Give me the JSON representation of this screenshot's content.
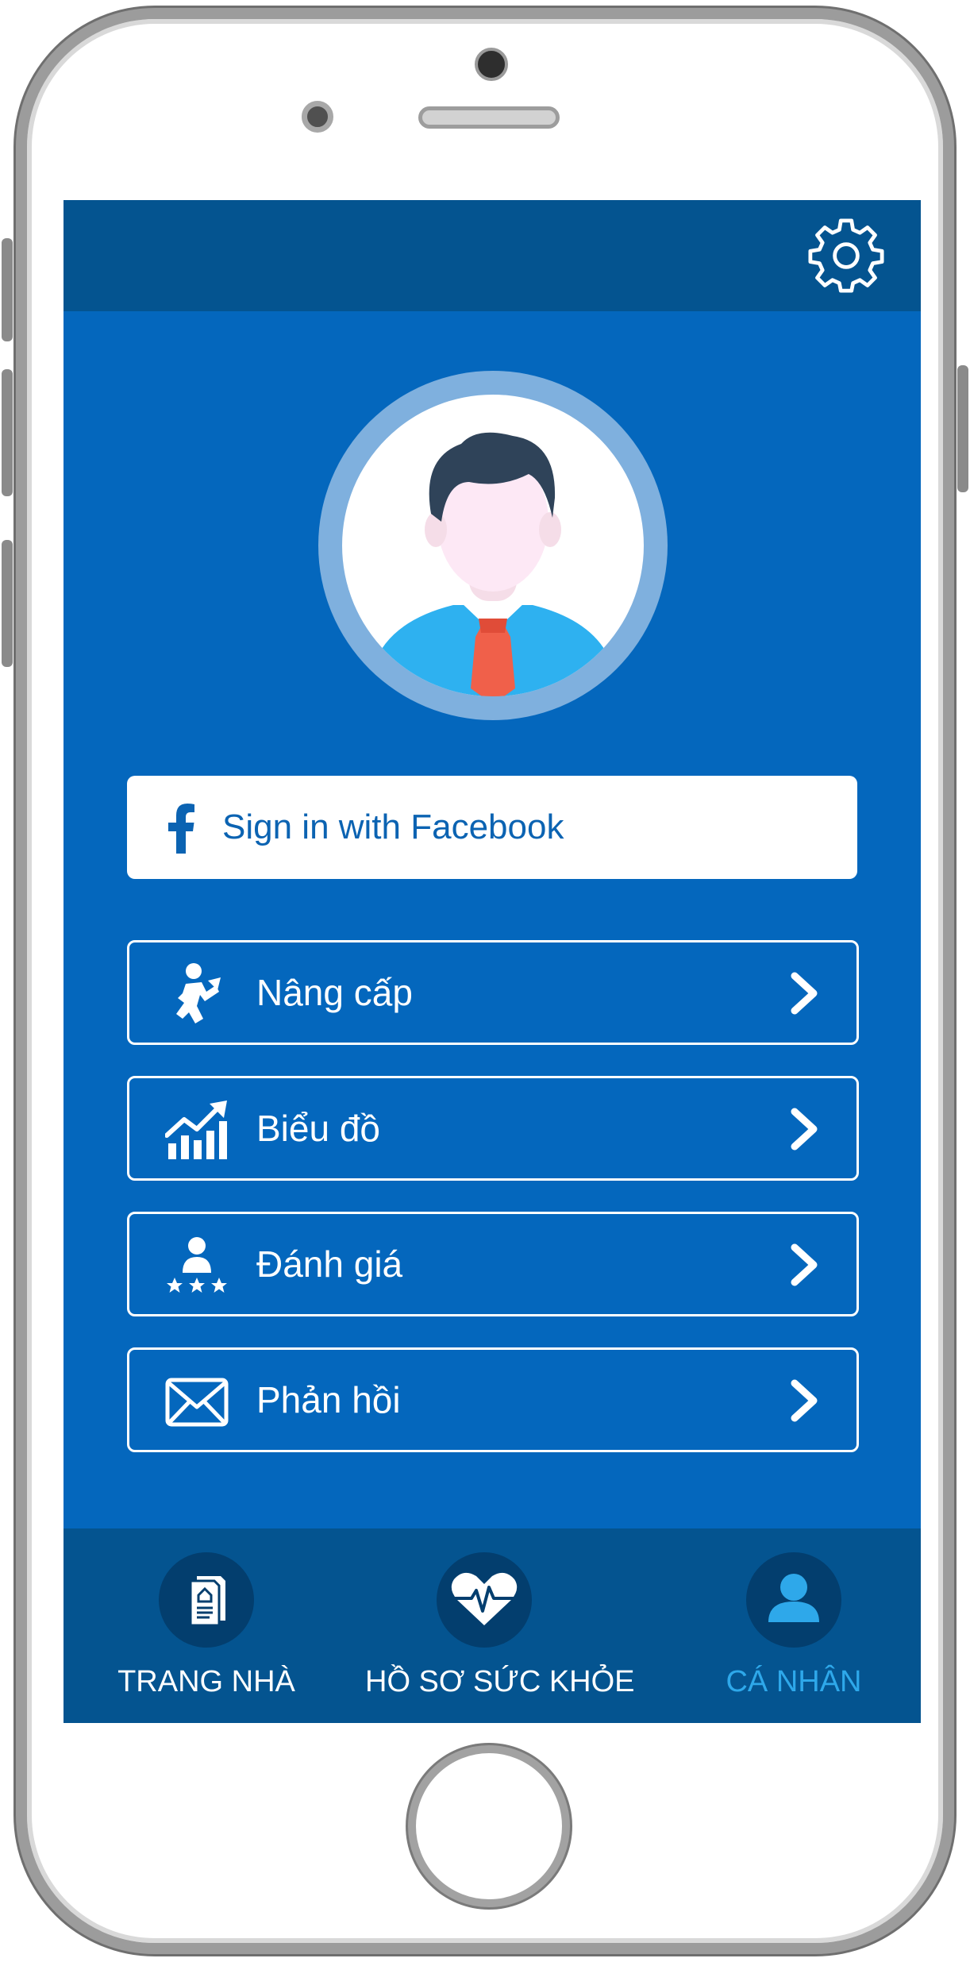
{
  "header": {
    "settings_icon": "gear-icon"
  },
  "profile": {
    "avatar_icon": "user-avatar-illustration"
  },
  "facebook": {
    "label": "Sign in with Facebook",
    "icon": "facebook-icon"
  },
  "menu": [
    {
      "label": "Nâng cấp",
      "icon": "upgrade-person-icon"
    },
    {
      "label": "Biểu đồ",
      "icon": "chart-growth-icon"
    },
    {
      "label": "Đánh giá",
      "icon": "rating-stars-icon"
    },
    {
      "label": "Phản hồi",
      "icon": "envelope-icon"
    }
  ],
  "nav": [
    {
      "label": "TRANG NHÀ",
      "icon": "document-home-icon",
      "active": false
    },
    {
      "label": "HỒ SƠ SỨC KHỎE",
      "icon": "heart-pulse-icon",
      "active": false
    },
    {
      "label": "CÁ NHÂN",
      "icon": "person-icon",
      "active": true
    }
  ],
  "colors": {
    "screen_bg": "#0467bd",
    "bar_bg": "#045490",
    "accent": "#2ea8ea",
    "facebook_text": "#0b63b2"
  }
}
